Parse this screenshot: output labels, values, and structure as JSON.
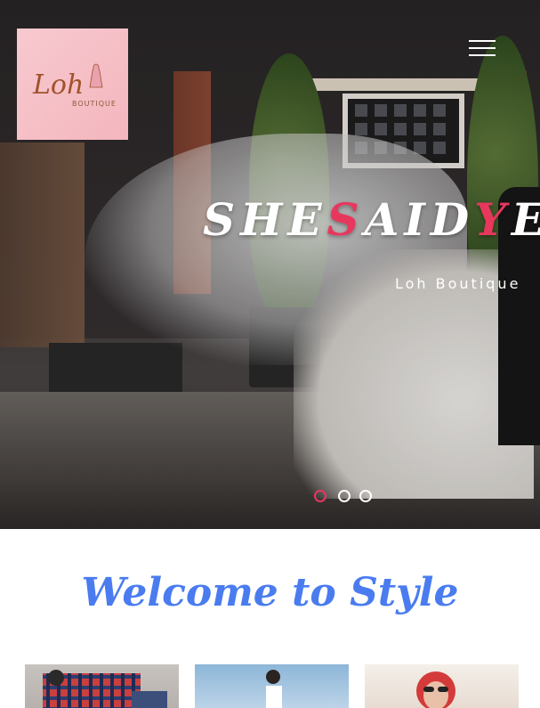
{
  "header": {
    "logo": {
      "script_text": "Loh",
      "sub_text": "BOUTIQUE"
    },
    "menu_icon": "hamburger-menu-icon"
  },
  "hero": {
    "headline": {
      "part1": "SHE",
      "accent1": "S",
      "part2": "AID",
      "accent2": "Y",
      "part3": "ES"
    },
    "subtitle": "Loh Boutique",
    "slides": {
      "count": 3,
      "active_index": 0
    },
    "colors": {
      "accent": "#e8375d",
      "text": "#ffffff"
    }
  },
  "main": {
    "welcome_title": "Welcome to Style",
    "title_color": "#4a7cf0"
  }
}
